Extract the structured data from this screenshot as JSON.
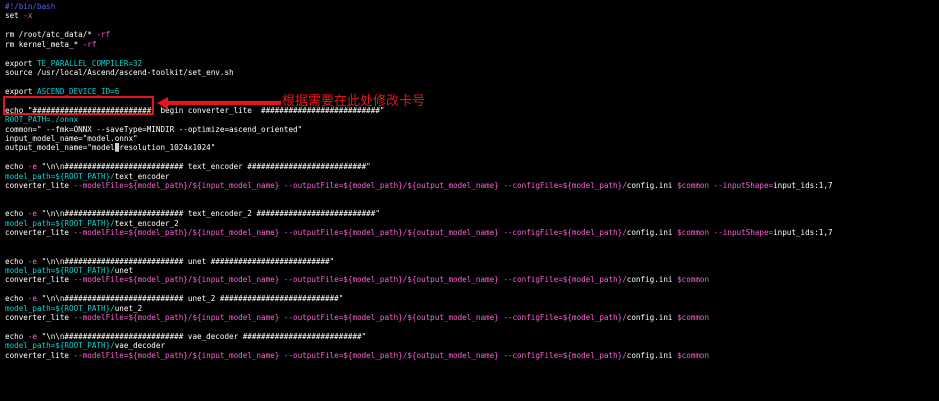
{
  "colors": {
    "background": "#000000",
    "comment": "#5f5fff",
    "plain": "#ffffff",
    "variable": "#00d7d7",
    "string": "#ffd75f",
    "option": "#ff5fd7",
    "annotation": "#e8141a"
  },
  "annotation": {
    "label": "根据需要在此处修改卡号",
    "arrow_icon": "arrow-left-icon"
  },
  "lines": [
    [
      {
        "t": "#!/bin/bash",
        "c": "comment"
      }
    ],
    [
      {
        "t": "set ",
        "c": "white"
      },
      {
        "t": "-x",
        "c": "magenta"
      }
    ],
    [],
    [
      {
        "t": "rm /root/atc_data/* ",
        "c": "white"
      },
      {
        "t": "-rf",
        "c": "magenta"
      }
    ],
    [
      {
        "t": "rm kernel_meta_* ",
        "c": "white"
      },
      {
        "t": "-rf",
        "c": "magenta"
      }
    ],
    [],
    [
      {
        "t": "export ",
        "c": "white"
      },
      {
        "t": "TE_PARALLEL_COMPILER=32",
        "c": "cyan"
      }
    ],
    [
      {
        "t": "source /usr/local/Ascend/ascend-toolkit/set_env.sh",
        "c": "white"
      }
    ],
    [],
    [
      {
        "t": "export ",
        "c": "white"
      },
      {
        "t": "ASCEND_DEVICE_ID=6",
        "c": "cyan"
      }
    ],
    [],
    [
      {
        "t": "echo ",
        "c": "white"
      },
      {
        "t": "\"##########################  begin converter_lite  ##########################\"",
        "c": "string"
      }
    ],
    [
      {
        "t": "ROOT_PATH=./onnx",
        "c": "cyan"
      }
    ],
    [
      {
        "t": "common=\" --fmk=ONNX --saveType=MINDIR --optimize=ascend_oriented\"",
        "c": "string"
      }
    ],
    [
      {
        "t": "input_model_name=\"model.onnx\"",
        "c": "string"
      }
    ],
    [
      {
        "t": "output_model_name=\"model",
        "c": "string"
      },
      {
        "t": "_",
        "c": "cursor"
      },
      {
        "t": "resolution_1024x1024\"",
        "c": "string"
      }
    ],
    [],
    [
      {
        "t": "echo ",
        "c": "white"
      },
      {
        "t": "-e ",
        "c": "magenta"
      },
      {
        "t": "\"\\n\\n########################## text_encoder ##########################\"",
        "c": "string"
      }
    ],
    [
      {
        "t": "model_path=${ROOT_PATH}/",
        "c": "cyan"
      },
      {
        "t": "text_encoder",
        "c": "white"
      }
    ],
    [
      {
        "t": "converter_lite ",
        "c": "white"
      },
      {
        "t": "--modelFile=${model_path}/${input_model_name} --outputFile=${model_path}/${output_model_name} --configFile=${model_path}/",
        "c": "magenta"
      },
      {
        "t": "config.ini ",
        "c": "white"
      },
      {
        "t": "$common --inputShape=",
        "c": "magenta"
      },
      {
        "t": "input_ids:1,7",
        "c": "white"
      }
    ],
    [],
    [],
    [
      {
        "t": "echo ",
        "c": "white"
      },
      {
        "t": "-e ",
        "c": "magenta"
      },
      {
        "t": "\"\\n\\n########################## text_encoder_2 ##########################\"",
        "c": "string"
      }
    ],
    [
      {
        "t": "model_path=${ROOT_PATH}/",
        "c": "cyan"
      },
      {
        "t": "text_encoder_2",
        "c": "white"
      }
    ],
    [
      {
        "t": "converter_lite ",
        "c": "white"
      },
      {
        "t": "--modelFile=${model_path}/${input_model_name} --outputFile=${model_path}/${output_model_name} --configFile=${model_path}/",
        "c": "magenta"
      },
      {
        "t": "config.ini ",
        "c": "white"
      },
      {
        "t": "$common --inputShape=",
        "c": "magenta"
      },
      {
        "t": "input_ids:1,7",
        "c": "white"
      }
    ],
    [],
    [],
    [
      {
        "t": "echo ",
        "c": "white"
      },
      {
        "t": "-e ",
        "c": "magenta"
      },
      {
        "t": "\"\\n\\n########################## unet ##########################\"",
        "c": "string"
      }
    ],
    [
      {
        "t": "model_path=${ROOT_PATH}/",
        "c": "cyan"
      },
      {
        "t": "unet",
        "c": "white"
      }
    ],
    [
      {
        "t": "converter_lite ",
        "c": "white"
      },
      {
        "t": "--modelFile=${model_path}/${input_model_name} --outputFile=${model_path}/${output_model_name} --configFile=${model_path}/",
        "c": "magenta"
      },
      {
        "t": "config.ini ",
        "c": "white"
      },
      {
        "t": "$common",
        "c": "magenta"
      }
    ],
    [],
    [
      {
        "t": "echo ",
        "c": "white"
      },
      {
        "t": "-e ",
        "c": "magenta"
      },
      {
        "t": "\"\\n\\n########################## unet_2 ##########################\"",
        "c": "string"
      }
    ],
    [
      {
        "t": "model_path=${ROOT_PATH}/",
        "c": "cyan"
      },
      {
        "t": "unet_2",
        "c": "white"
      }
    ],
    [
      {
        "t": "converter_lite ",
        "c": "white"
      },
      {
        "t": "--modelFile=${model_path}/${input_model_name} --outputFile=${model_path}/${output_model_name} --configFile=${model_path}/",
        "c": "magenta"
      },
      {
        "t": "config.ini ",
        "c": "white"
      },
      {
        "t": "$common",
        "c": "magenta"
      }
    ],
    [],
    [
      {
        "t": "echo ",
        "c": "white"
      },
      {
        "t": "-e ",
        "c": "magenta"
      },
      {
        "t": "\"\\n\\n########################## vae_decoder ##########################\"",
        "c": "string"
      }
    ],
    [
      {
        "t": "model_path=${ROOT_PATH}/",
        "c": "cyan"
      },
      {
        "t": "vae_decoder",
        "c": "white"
      }
    ],
    [
      {
        "t": "converter_lite ",
        "c": "white"
      },
      {
        "t": "--modelFile=${model_path}/${input_model_name} --outputFile=${model_path}/${output_model_name} --configFile=${model_path}/",
        "c": "magenta"
      },
      {
        "t": "config.ini ",
        "c": "white"
      },
      {
        "t": "$common",
        "c": "magenta"
      }
    ]
  ]
}
